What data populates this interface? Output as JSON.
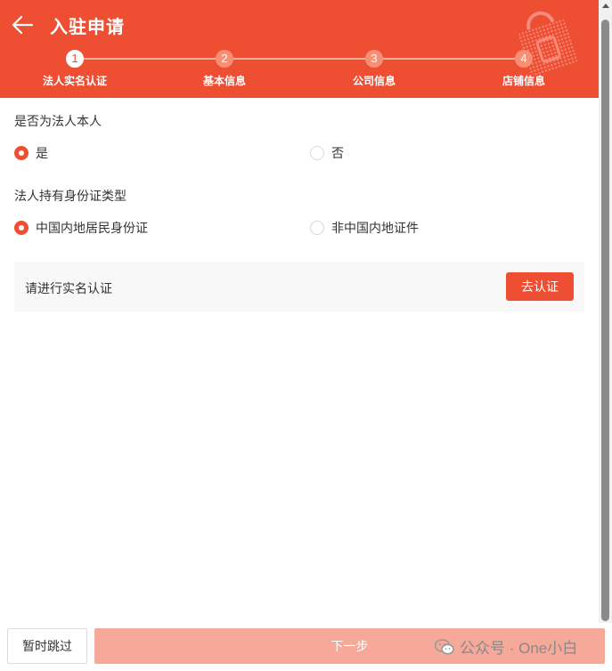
{
  "header": {
    "title": "入驻申请"
  },
  "steps": [
    {
      "num": "1",
      "label": "法人实名认证"
    },
    {
      "num": "2",
      "label": "基本信息"
    },
    {
      "num": "3",
      "label": "公司信息"
    },
    {
      "num": "4",
      "label": "店铺信息"
    }
  ],
  "form": {
    "is_legal_person": {
      "label": "是否为法人本人",
      "options": [
        "是",
        "否"
      ],
      "selected": "是"
    },
    "id_type": {
      "label": "法人持有身份证类型",
      "options": [
        "中国内地居民身份证",
        "非中国内地证件"
      ],
      "selected": "中国内地居民身份证"
    }
  },
  "verify": {
    "prompt": "请进行实名认证",
    "button": "去认证"
  },
  "footer": {
    "skip": "暂时跳过",
    "next": "下一步"
  },
  "watermark": {
    "text": "公众号 · One小白"
  },
  "colors": {
    "brand": "#ee4f33",
    "disabled_button": "#f6a899"
  },
  "icons": {
    "back": "arrow-left",
    "decoration": "shopping-bag",
    "watermark": "wechat"
  }
}
